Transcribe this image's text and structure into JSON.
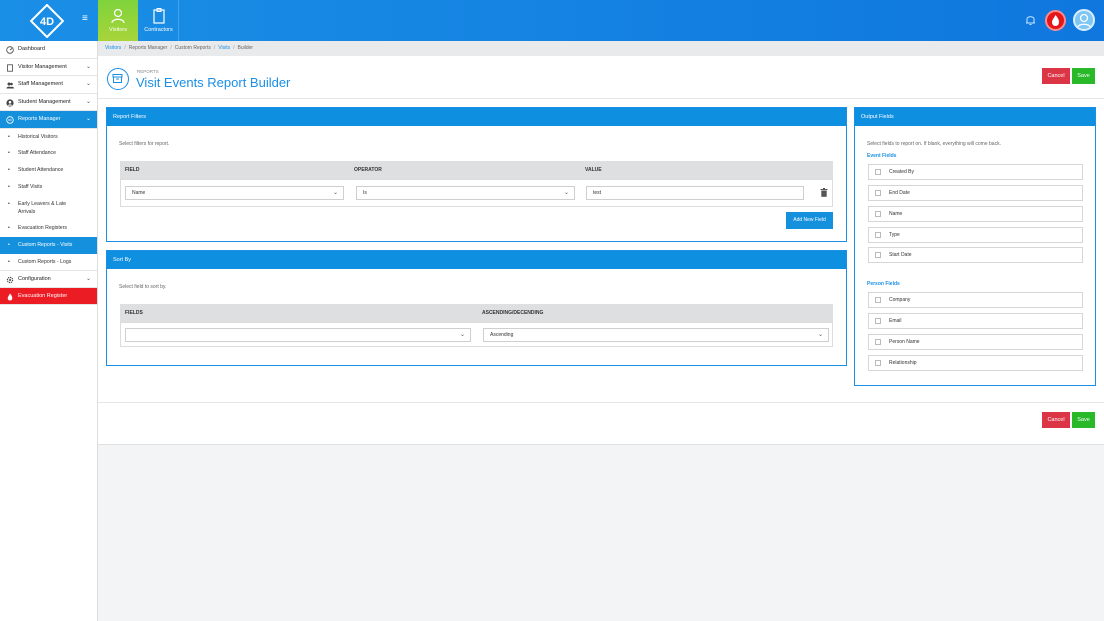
{
  "topbar": {
    "logo_text": "4D",
    "nav": [
      {
        "label": "Visitors",
        "icon": "visitor-icon",
        "active": true
      },
      {
        "label": "Contractors",
        "icon": "clipboard-icon",
        "active": false
      }
    ],
    "colors": {
      "bar": "#1a8fe6",
      "visitors_tab": "#8fd43a",
      "evacuation": "#e5161a"
    }
  },
  "sidebar": {
    "items": [
      {
        "label": "Dashboard",
        "icon": "dashboard-icon",
        "expandable": false
      },
      {
        "label": "Visitor Management",
        "icon": "document-icon",
        "expandable": true
      },
      {
        "label": "Staff Management",
        "icon": "people-icon",
        "expandable": true
      },
      {
        "label": "Student Management",
        "icon": "person-icon",
        "expandable": true
      },
      {
        "label": "Reports Manager",
        "icon": "reports-icon",
        "expandable": true,
        "active": true
      }
    ],
    "reports_sub": [
      "Historical Visitors",
      "Staff Attendance",
      "Student Attendance",
      "Staff Visits",
      "Early Leavers & Late Arrivals",
      "Evacuation Registers",
      "Custom Reports - Visits",
      "Custom Reports - Logs"
    ],
    "configuration": "Configuration",
    "evacuation": "Evacuation Register"
  },
  "breadcrumb": {
    "items": [
      "Visitors",
      "Reports Manager",
      "Custom Reports",
      "Visits",
      "Builder"
    ]
  },
  "header": {
    "subtitle": "REPORTS",
    "title": "Visit Events Report Builder",
    "cancel": "Cancel",
    "save": "Save"
  },
  "filters": {
    "title": "Report Filters",
    "hint": "Select filters for report.",
    "columns": [
      "FIELD",
      "OPERATOR",
      "VALUE"
    ],
    "row": {
      "field": "Name",
      "operator": "Is",
      "value": "test"
    },
    "add_button": "Add New Field"
  },
  "sort": {
    "title": "Sort By",
    "hint": "Select field to sort by.",
    "columns": [
      "FIELDS",
      "ASCENDING/DECENDING"
    ],
    "field_value": "",
    "order_value": "Ascending"
  },
  "output": {
    "title": "Output Fields",
    "hint": "Select fields to report on. If blank, everything will come back.",
    "event_label": "Event Fields",
    "event_fields": [
      "Created By",
      "End Date",
      "Name",
      "Type",
      "Start Date"
    ],
    "person_label": "Person Fields",
    "person_fields": [
      "Company",
      "Email",
      "Person Name",
      "Relationship"
    ]
  },
  "footer": {
    "cancel": "Cancel",
    "save": "Save"
  }
}
